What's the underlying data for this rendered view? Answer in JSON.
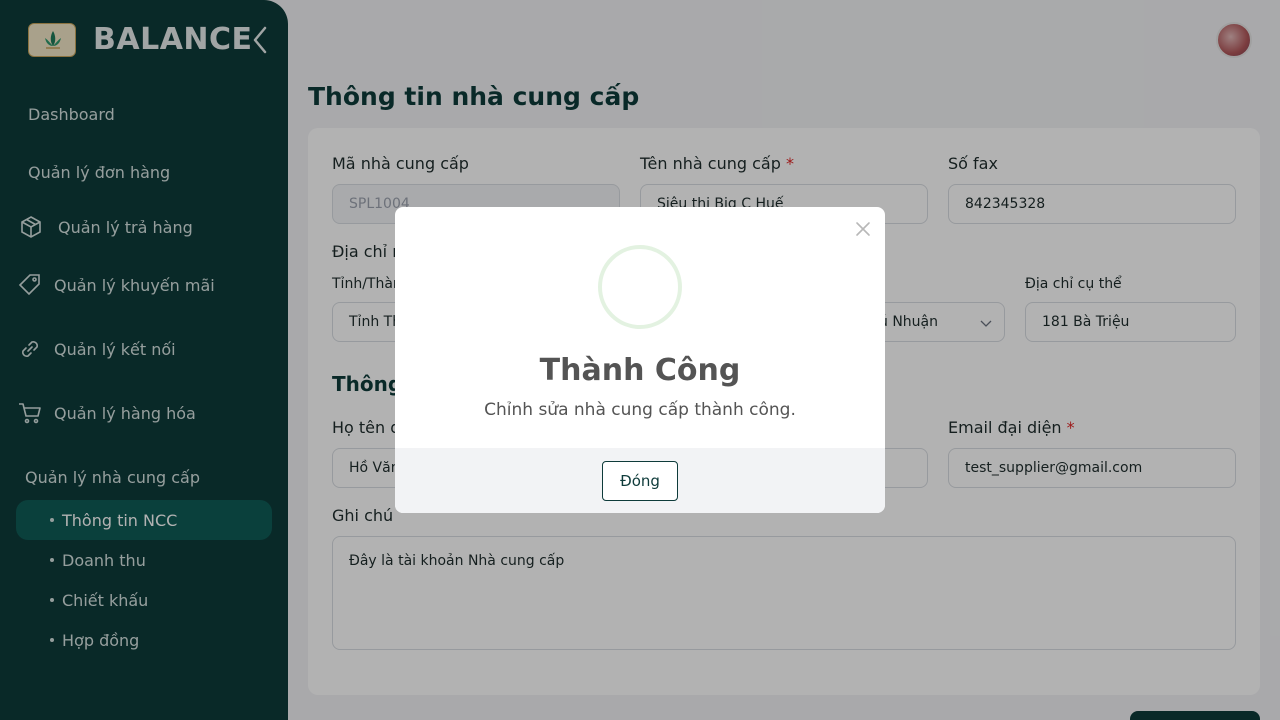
{
  "app": {
    "name": "BALANCE"
  },
  "sidebar": {
    "items": [
      {
        "label": "Dashboard"
      },
      {
        "label": "Quản lý đơn hàng"
      },
      {
        "label": "Quản lý trả hàng",
        "icon": "package-return-icon"
      },
      {
        "label": "Quản lý khuyến mãi",
        "icon": "tag-icon"
      },
      {
        "label": "Quản lý kết nối",
        "icon": "link-icon"
      },
      {
        "label": "Quản lý hàng hóa",
        "icon": "cart-icon"
      }
    ],
    "group": {
      "label": "Quản lý nhà cung cấp",
      "subitems": [
        {
          "label": "Thông tin NCC",
          "active": true
        },
        {
          "label": "Doanh thu"
        },
        {
          "label": "Chiết khấu"
        },
        {
          "label": "Hợp đồng"
        }
      ]
    }
  },
  "page": {
    "title": "Thông tin nhà cung cấp"
  },
  "form": {
    "supplier_code_label": "Mã nhà cung cấp",
    "supplier_code_value": "SPL1004",
    "supplier_name_label": "Tên nhà cung cấp",
    "supplier_name_value": "Siêu thị Big C Huế",
    "fax_label": "Số fax",
    "fax_value": "842345328",
    "address_section_partial": "Địa chỉ n",
    "province_label_partial": "Tỉnh/Thàn",
    "province_value_partial": "Tỉnh Th",
    "district_value_partial": "ú Nhuận",
    "address_detail_label": "Địa chỉ cụ thể",
    "address_detail_value": "181 Bà Triệu",
    "contact_section_partial": "Thông",
    "rep_name_label_partial": "Họ tên đ",
    "rep_name_value_partial": "Hồ Văn",
    "rep_email_label": "Email đại diện",
    "rep_email_value": "test_supplier@gmail.com",
    "note_label": "Ghi chú",
    "note_value": "Đây là tài khoản Nhà cung cấp",
    "required_mark": "*"
  },
  "modal": {
    "title": "Thành Công",
    "message": "Chỉnh sửa nhà cung cấp thành công.",
    "button_label": "Đóng"
  },
  "colors": {
    "sidebar_bg": "#0e3b3a",
    "active_item_bg": "#0f5c57",
    "accent": "#0e3b3a",
    "required": "#e02424"
  }
}
